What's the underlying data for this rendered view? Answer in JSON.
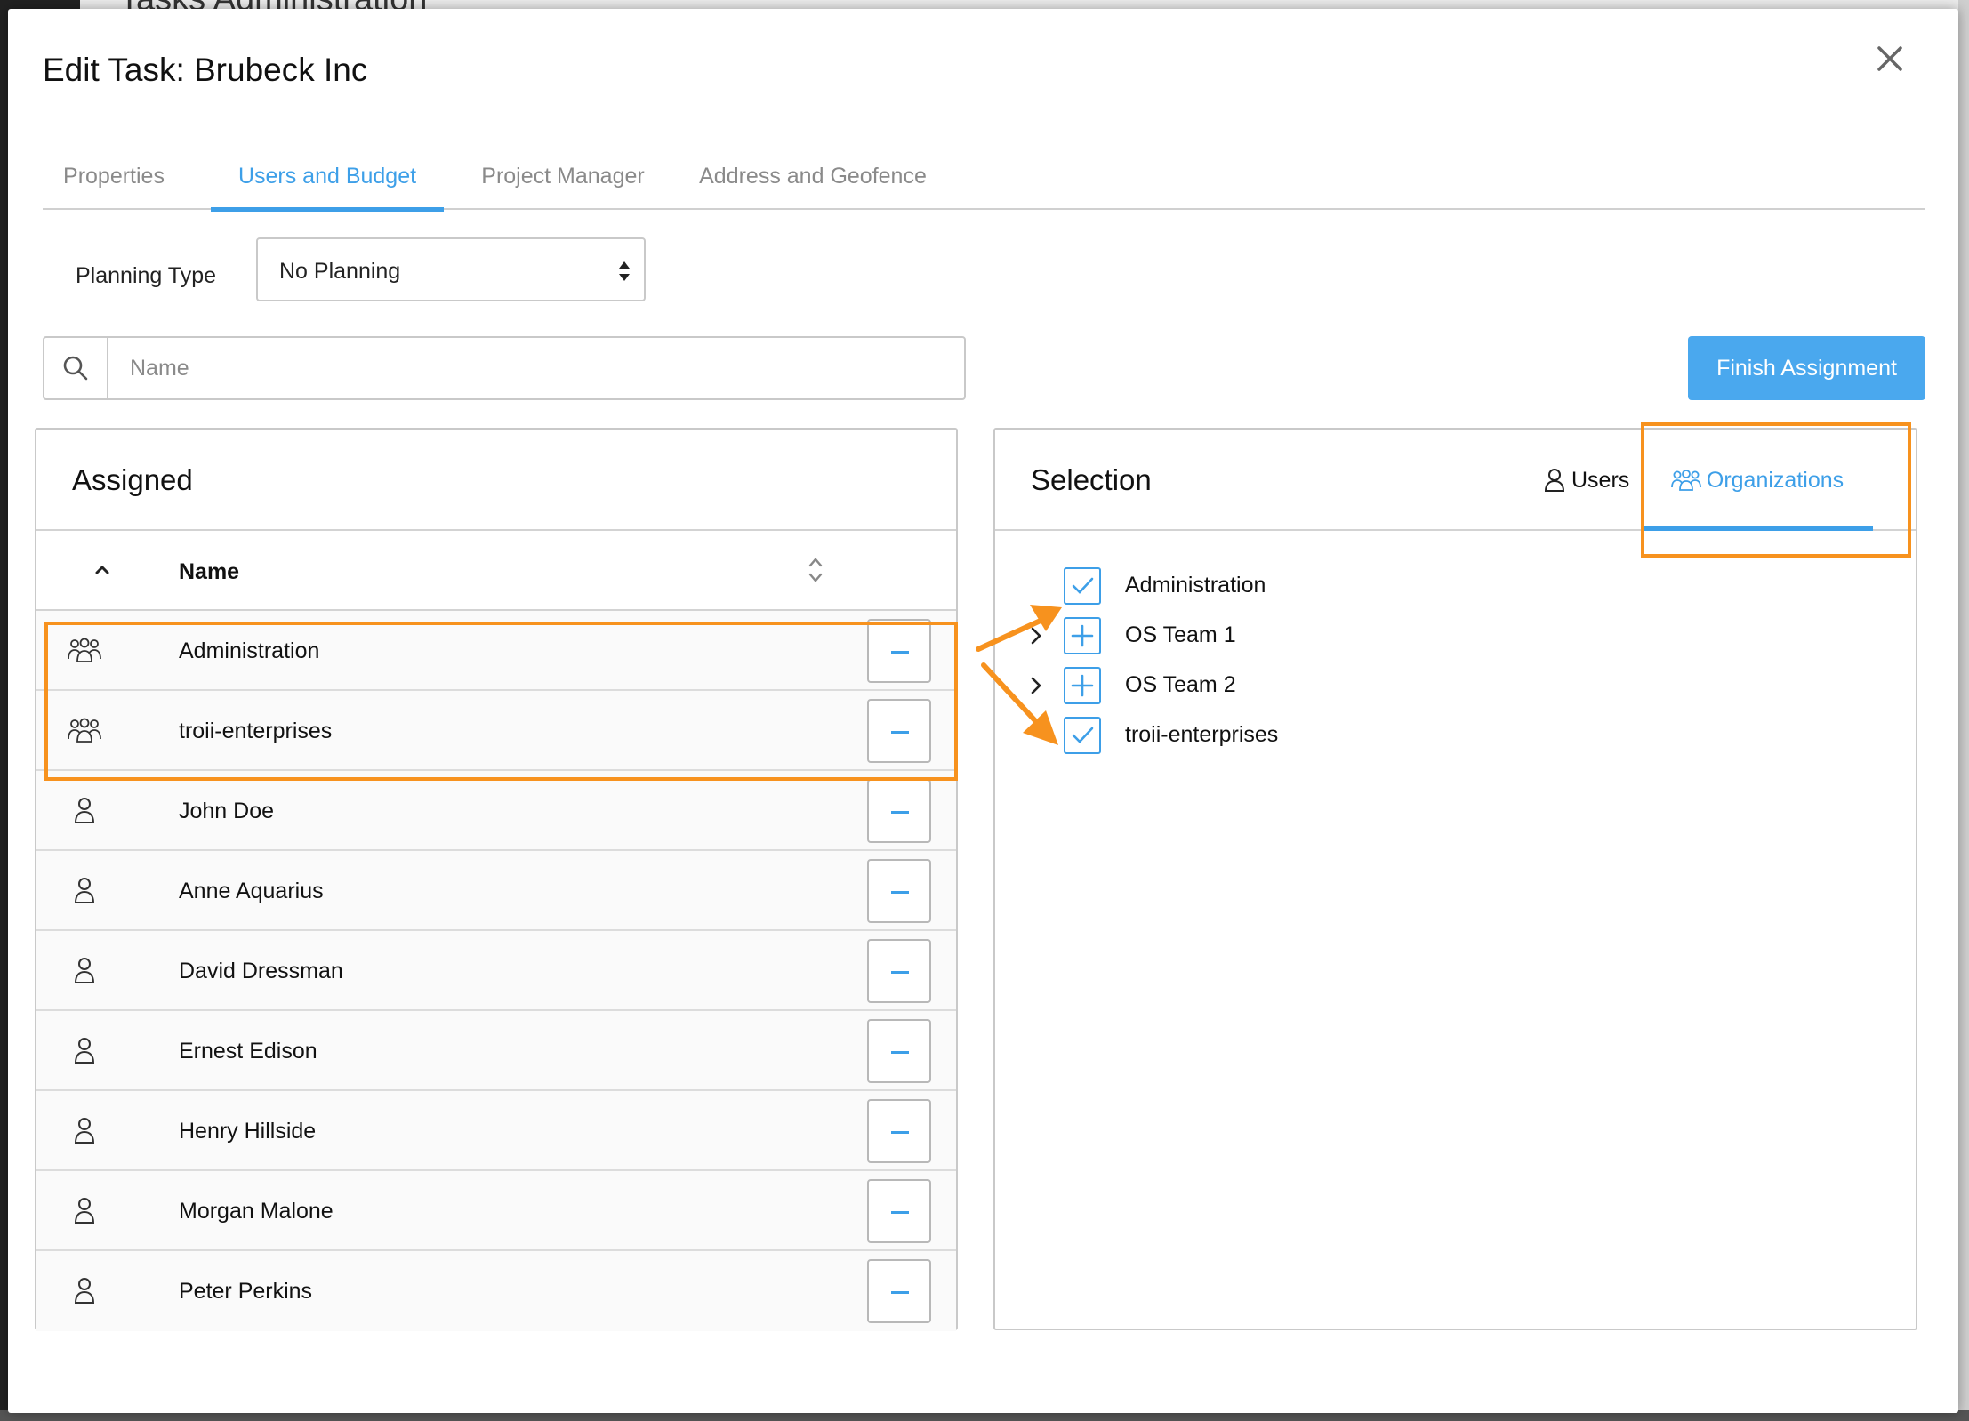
{
  "background": {
    "page_title": "Tasks Administration"
  },
  "modal": {
    "title": "Edit Task: Brubeck Inc",
    "close_icon": "close-icon"
  },
  "tabs": [
    {
      "label": "Properties",
      "active": false
    },
    {
      "label": "Users and Budget",
      "active": true
    },
    {
      "label": "Project Manager",
      "active": false
    },
    {
      "label": "Address and Geofence",
      "active": false
    }
  ],
  "planning": {
    "label": "Planning Type",
    "value": "No Planning"
  },
  "search": {
    "placeholder": "Name",
    "value": ""
  },
  "finish_button": {
    "label": "Finish Assignment"
  },
  "assigned": {
    "title": "Assigned",
    "column_name": "Name",
    "rows": [
      {
        "name": "Administration",
        "type": "organization",
        "icon": "organization-icon"
      },
      {
        "name": "troii-enterprises",
        "type": "organization",
        "icon": "organization-icon"
      },
      {
        "name": "John Doe",
        "type": "user",
        "icon": "user-icon"
      },
      {
        "name": "Anne Aquarius",
        "type": "user",
        "icon": "user-icon"
      },
      {
        "name": "David Dressman",
        "type": "user",
        "icon": "user-icon"
      },
      {
        "name": "Ernest Edison",
        "type": "user",
        "icon": "user-icon"
      },
      {
        "name": "Henry Hillside",
        "type": "user",
        "icon": "user-icon"
      },
      {
        "name": "Morgan Malone",
        "type": "user",
        "icon": "user-icon"
      },
      {
        "name": "Peter Perkins",
        "type": "user",
        "icon": "user-icon"
      }
    ]
  },
  "selection": {
    "title": "Selection",
    "tab_users": "Users",
    "tab_organizations": "Organizations",
    "active_tab": "Organizations",
    "tree": [
      {
        "label": "Administration",
        "checked": true,
        "expandable": false
      },
      {
        "label": "OS Team 1",
        "checked": false,
        "expandable": true
      },
      {
        "label": "OS Team 2",
        "checked": false,
        "expandable": true
      },
      {
        "label": "troii-enterprises",
        "checked": true,
        "expandable": false
      }
    ]
  },
  "colors": {
    "accent": "#3d9fe8",
    "button": "#4aa8ee",
    "annotation": "#f7921e"
  }
}
